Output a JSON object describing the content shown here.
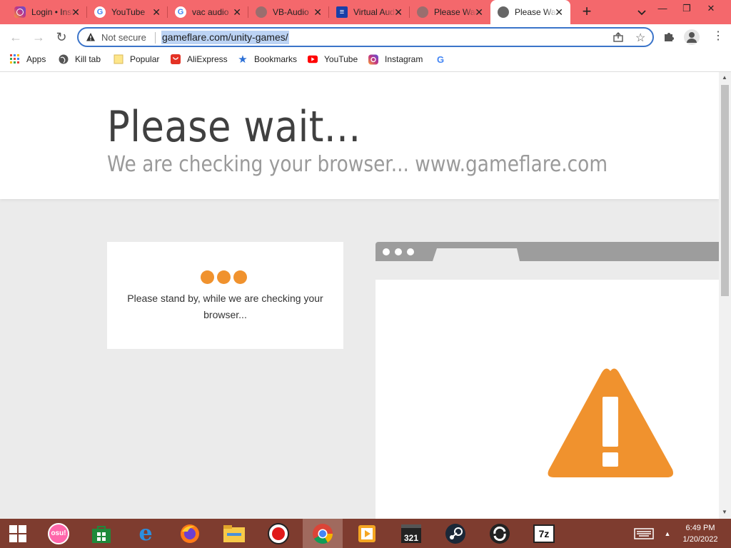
{
  "tabs": [
    {
      "label": "Login • Instagram",
      "icon": "instagram-icon",
      "color": "#c13584"
    },
    {
      "label": "YouTube",
      "icon": "google-icon",
      "color": "#4285f4"
    },
    {
      "label": "vac audio",
      "icon": "google-icon",
      "color": "#4285f4"
    },
    {
      "label": "VB-Audio",
      "icon": "globe-icon",
      "color": "#8b5a5a"
    },
    {
      "label": "Virtual Audio",
      "icon": "vb-icon",
      "color": "#1a3fa8"
    },
    {
      "label": "Please Wait",
      "icon": "globe-icon",
      "color": "#8b5a5a"
    },
    {
      "label": "Please Wait",
      "icon": "globe-icon",
      "color": "#666666",
      "active": true
    }
  ],
  "omnibox": {
    "security_label": "Not secure",
    "url": "gameflare.com/unity-games/"
  },
  "bookmarks": [
    {
      "label": "Apps",
      "icon": "apps-grid-icon"
    },
    {
      "label": "Kill tab",
      "icon": "globe-icon"
    },
    {
      "label": "Popular",
      "icon": "folder-icon"
    },
    {
      "label": "AliExpress",
      "icon": "aliexpress-icon"
    },
    {
      "label": "Bookmarks",
      "icon": "star-icon"
    },
    {
      "label": "YouTube",
      "icon": "youtube-icon"
    },
    {
      "label": "Instagram",
      "icon": "instagram-icon"
    },
    {
      "label": "",
      "icon": "google-icon"
    }
  ],
  "page": {
    "title": "Please wait...",
    "subtitle": "We are checking your browser... www.gameflare.com",
    "card_text": "Please stand by, while we are checking your browser...",
    "accent_color": "#f0922e"
  },
  "taskbar": {
    "apps": [
      "start-icon",
      "osu-icon",
      "store-icon",
      "edge-icon",
      "firefox-icon",
      "explorer-icon",
      "obs-icon",
      "chrome-icon",
      "vlc-icon",
      "mpc-icon",
      "steam-icon",
      "sync-icon",
      "7zip-icon"
    ],
    "osu_label": "osu!",
    "mpc_label": "321",
    "sevenzip_label": "7z",
    "time": "6:49 PM",
    "date": "1/20/2022",
    "color": "#7e3c2f"
  }
}
